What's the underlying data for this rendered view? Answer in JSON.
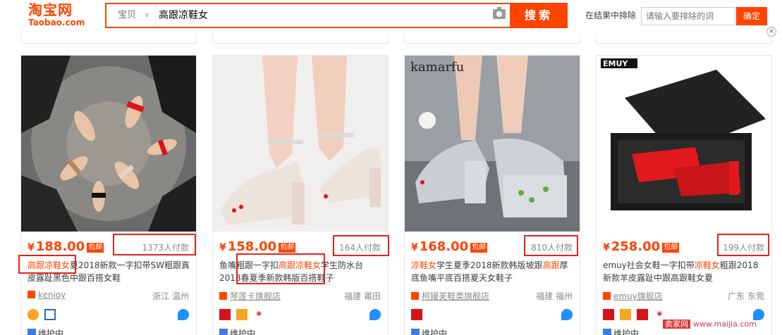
{
  "header": {
    "logo_cn": "淘宝网",
    "logo_en": "Taobao.com",
    "search_type": "宝贝",
    "search_query": "高跟凉鞋女",
    "search_button": "搜索",
    "exclude_label": "在结果中排除",
    "exclude_placeholder": "请输入要排除的词",
    "exclude_button": "确定"
  },
  "products": [
    {
      "price": "188.00",
      "baoyou": "包邮",
      "deal": "1373人付款",
      "title_hl": "高跟凉鞋女",
      "title_rest": "夏2018新款一字扣带SW粗跟真皮露趾黑色中跟百搭女鞋",
      "shop": "kenjoy",
      "location": "浙江 温州",
      "weihu": "维护中"
    },
    {
      "price": "158.00",
      "baoyou": "包邮",
      "deal": "164人付款",
      "title_pre": "鱼嘴粗跟一字扣",
      "title_hl": "高跟凉鞋女",
      "title_rest": "学生防水台2018春夏季新款韩版百搭鞋子",
      "shop": "琴莲卡旗舰店",
      "location": "福建 莆田",
      "weihu": "维护中"
    },
    {
      "price": "168.00",
      "baoyou": "包邮",
      "deal": "810人付款",
      "title_hl": "凉鞋女",
      "title_mid": "学生夏季2018新款韩版坡跟",
      "title_hl2": "高跟",
      "title_rest": "厚底鱼嘴平底百搭夏天女鞋子",
      "shop": "柯嫚芙鞋类旗舰店",
      "location": "福建 福州",
      "weihu": "维护中"
    },
    {
      "price": "258.00",
      "baoyou": "包邮",
      "deal": "199人付款",
      "title_pre": "emuy社会女鞋一字扣带",
      "title_hl": "凉鞋女",
      "title_rest": "粗跟2018新款羊皮露趾中跟高跟鞋女夏",
      "shop": "emuy旗舰店",
      "location": "广东 东莞",
      "weihu": "维护中"
    }
  ],
  "image_text": {
    "brand3": "kamarfu",
    "brand4": "EMUY"
  },
  "watermark": {
    "cn": "卖家网",
    "url": "www.maijia.com"
  },
  "colors": {
    "accent": "#ff4400",
    "annotation_red": "#e8201c"
  }
}
